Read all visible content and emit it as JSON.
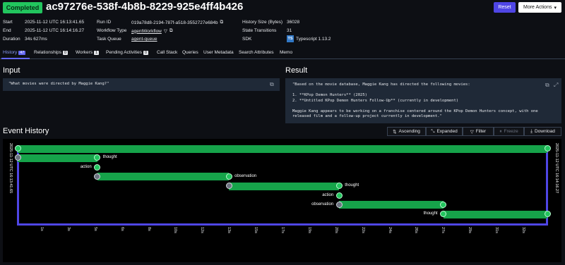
{
  "header": {
    "status": "Completed",
    "workflow_id": "ac97276e-538f-4b8b-8229-925e4ff4b426",
    "reset_label": "Reset",
    "more_actions_label": "More Actions"
  },
  "meta": {
    "start_label": "Start",
    "start_value": "2025-11-12 UTC 16:13:41.65",
    "end_label": "End",
    "end_value": "2025-11-12 UTC 16:14:16.27",
    "duration_label": "Duration",
    "duration_value": "34s 627ms",
    "run_id_label": "Run ID",
    "run_id_value": "019a78d8-2194-787f-a518-3552727e684b",
    "workflow_type_label": "Workflow Type",
    "workflow_type_value": "agentWorkflow",
    "task_queue_label": "Task Queue",
    "task_queue_value": "agent-queue",
    "history_size_label": "History Size (Bytes)",
    "history_size_value": "36028",
    "state_transitions_label": "State Transitions",
    "state_transitions_value": "31",
    "sdk_label": "SDK",
    "sdk_badge": "TS",
    "sdk_value": "Typescript 1.13.2"
  },
  "tabs": [
    {
      "label": "History",
      "count": "47",
      "active": true
    },
    {
      "label": "Relationships",
      "count": "0"
    },
    {
      "label": "Workers",
      "count": "1"
    },
    {
      "label": "Pending Activities",
      "count": "0"
    },
    {
      "label": "Call Stack"
    },
    {
      "label": "Queries"
    },
    {
      "label": "User Metadata"
    },
    {
      "label": "Search Attributes"
    },
    {
      "label": "Memo"
    }
  ],
  "input": {
    "title": "Input",
    "content": "\"What movies were directed by Maggie Kang?\""
  },
  "result": {
    "title": "Result",
    "content": "\"Based on the movie database, Maggie Kang has directed the following movies:\n\n1. **KPop Demon Hunters** (2025)\n2. **Untitled KPop Demon Hunters Follow-Up** (currently in development)\n\nMaggie Kang appears to be working on a franchise centered around the KPop Demon Hunters concept, with one\nreleased film and a follow-up project currently in development.\""
  },
  "event_history": {
    "title": "Event History",
    "ascending_label": "Ascending",
    "expanded_label": "Expanded",
    "filter_label": "Filter",
    "freeze_label": "Freeze",
    "download_label": "Download",
    "start_time": "2025-11-12 UTC 16:13:41.65",
    "end_time": "2025-11-12 UTC 16:14:16.27",
    "events": [
      {
        "label": "",
        "start_s": 0.0,
        "end_s": 34.6,
        "status": "completed"
      },
      {
        "label": "thought",
        "start_s": 0.0,
        "end_s": 5.2,
        "status": "pending"
      },
      {
        "label": "action",
        "start_s": 5.2,
        "end_s": 5.2,
        "status": "completed"
      },
      {
        "label": "observation",
        "start_s": 5.2,
        "end_s": 13.8,
        "status": "pending"
      },
      {
        "label": "thought",
        "start_s": 13.8,
        "end_s": 21.0,
        "status": "pending"
      },
      {
        "label": "action",
        "start_s": 21.0,
        "end_s": 21.0,
        "status": "completed"
      },
      {
        "label": "observation",
        "start_s": 21.0,
        "end_s": 27.8,
        "status": "pending"
      },
      {
        "label": "thought",
        "start_s": 27.8,
        "end_s": 34.6,
        "status": "completed"
      }
    ],
    "ticks": [
      "1s",
      "3s",
      "5s",
      "6s",
      "8s",
      "10s",
      "12s",
      "13s",
      "15s",
      "17s",
      "19s",
      "20s",
      "22s",
      "24s",
      "26s",
      "27s",
      "29s",
      "31s",
      "32s"
    ]
  },
  "colors": {
    "accent": "#6366f1",
    "success": "#22c55e",
    "bar": "#16a34a",
    "pending": "#6b7280"
  }
}
